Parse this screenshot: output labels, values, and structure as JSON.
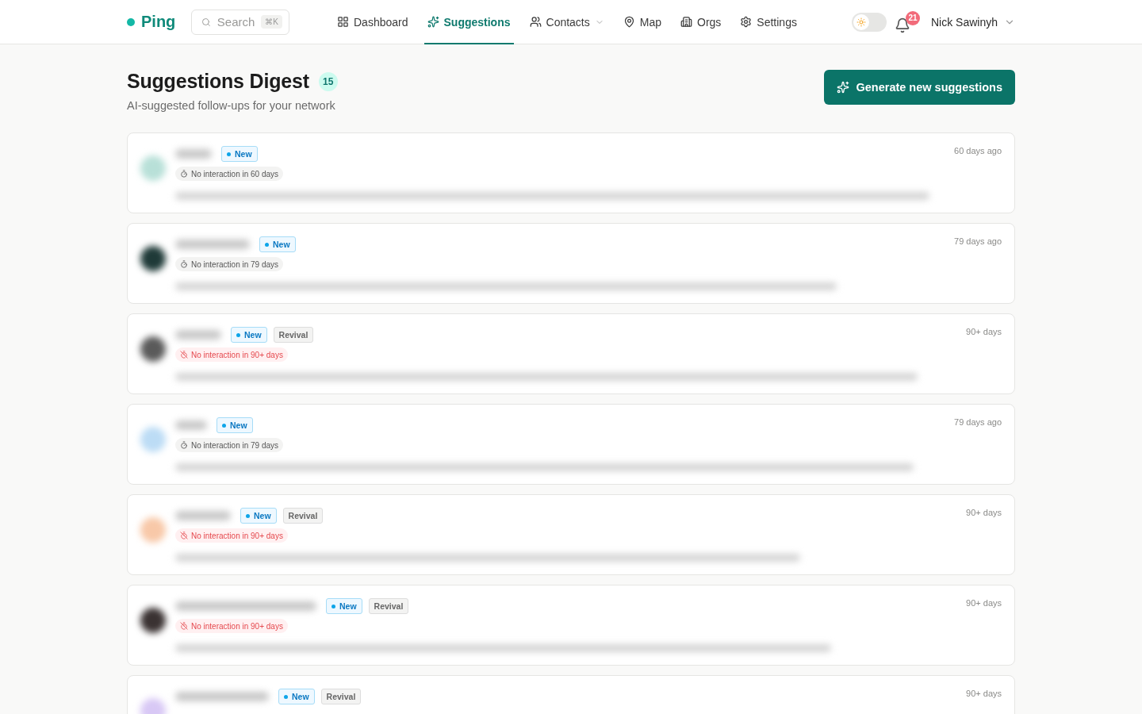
{
  "brand": "Ping",
  "search": {
    "placeholder": "Search",
    "shortcut": "⌘K"
  },
  "nav": [
    {
      "label": "Dashboard",
      "selected": false
    },
    {
      "label": "Suggestions",
      "selected": true
    },
    {
      "label": "Contacts",
      "selected": false,
      "dropdown": true
    },
    {
      "label": "Map",
      "selected": false
    },
    {
      "label": "Orgs",
      "selected": false
    },
    {
      "label": "Settings",
      "selected": false
    }
  ],
  "theme_toggle": {
    "on": false
  },
  "notifications": {
    "count": "21"
  },
  "user": {
    "name": "Nick Sawinyh"
  },
  "page": {
    "title": "Suggestions Digest",
    "count": "15",
    "subtitle": "AI-suggested follow-ups for your network",
    "action": "Generate new suggestions"
  },
  "suggestions": [
    {
      "color": "#b8e0d8",
      "tags": [
        {
          "label": "New",
          "kind": "new"
        }
      ],
      "interaction": {
        "text": "No interaction in 60 days",
        "kind": "stale"
      },
      "time": "60 days ago"
    },
    {
      "color": "#1f3a38",
      "tags": [
        {
          "label": "New",
          "kind": "new"
        }
      ],
      "interaction": {
        "text": "No interaction in 79 days",
        "kind": "stale"
      },
      "time": "79 days ago"
    },
    {
      "color": "#5a5a5a",
      "tags": [
        {
          "label": "New",
          "kind": "new"
        },
        {
          "label": "Revival",
          "kind": "revival"
        }
      ],
      "interaction": {
        "text": "No interaction in 90+ days",
        "kind": "overdue"
      },
      "time": "90+ days"
    },
    {
      "color": "#bcdcf5",
      "tags": [
        {
          "label": "New",
          "kind": "new"
        }
      ],
      "interaction": {
        "text": "No interaction in 79 days",
        "kind": "stale"
      },
      "time": "79 days ago"
    },
    {
      "color": "#f8c8a8",
      "tags": [
        {
          "label": "New",
          "kind": "new"
        },
        {
          "label": "Revival",
          "kind": "revival"
        }
      ],
      "interaction": {
        "text": "No interaction in 90+ days",
        "kind": "overdue"
      },
      "time": "90+ days"
    },
    {
      "color": "#3a3232",
      "tags": [
        {
          "label": "New",
          "kind": "new"
        },
        {
          "label": "Revival",
          "kind": "revival"
        }
      ],
      "interaction": {
        "text": "No interaction in 90+ days",
        "kind": "overdue"
      },
      "time": "90+ days"
    },
    {
      "color": "#d8c8f5",
      "tags": [
        {
          "label": "New",
          "kind": "new"
        },
        {
          "label": "Revival",
          "kind": "revival"
        }
      ],
      "time": "90+ days"
    }
  ]
}
